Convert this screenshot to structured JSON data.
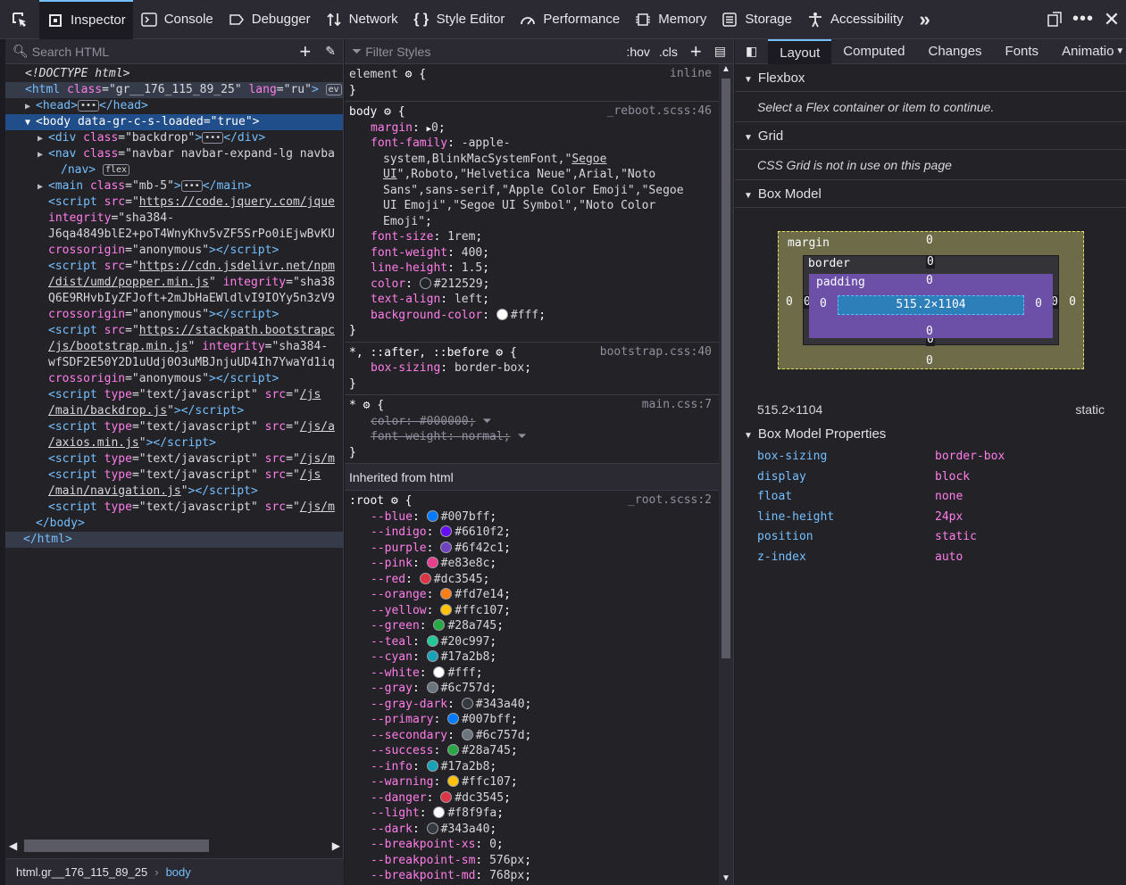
{
  "toolbar": {
    "tools": [
      "Inspector",
      "Console",
      "Debugger",
      "Network",
      "Style Editor",
      "Performance",
      "Memory",
      "Storage",
      "Accessibility"
    ]
  },
  "markup": {
    "search_placeholder": "Search HTML",
    "breadcrumb": [
      "html.gr__176_115_89_25",
      "body"
    ]
  },
  "rules": {
    "filter_placeholder": "Filter Styles",
    "hov": ":hov",
    "cls": ".cls",
    "inherited": "Inherited from html",
    "root_vars": [
      [
        "--blue",
        "#007bff",
        "#007bff"
      ],
      [
        "--indigo",
        "#6610f2",
        "#6610f2"
      ],
      [
        "--purple",
        "#6f42c1",
        "#6f42c1"
      ],
      [
        "--pink",
        "#e83e8c",
        "#e83e8c"
      ],
      [
        "--red",
        "#dc3545",
        "#dc3545"
      ],
      [
        "--orange",
        "#fd7e14",
        "#fd7e14"
      ],
      [
        "--yellow",
        "#ffc107",
        "#ffc107"
      ],
      [
        "--green",
        "#28a745",
        "#28a745"
      ],
      [
        "--teal",
        "#20c997",
        "#20c997"
      ],
      [
        "--cyan",
        "#17a2b8",
        "#17a2b8"
      ],
      [
        "--white",
        "#fff",
        "#ffffff"
      ],
      [
        "--gray",
        "#6c757d",
        "#6c757d"
      ],
      [
        "--gray-dark",
        "#343a40",
        "#343a40"
      ],
      [
        "--primary",
        "#007bff",
        "#007bff"
      ],
      [
        "--secondary",
        "#6c757d",
        "#6c757d"
      ],
      [
        "--success",
        "#28a745",
        "#28a745"
      ],
      [
        "--info",
        "#17a2b8",
        "#17a2b8"
      ],
      [
        "--warning",
        "#ffc107",
        "#ffc107"
      ],
      [
        "--danger",
        "#dc3545",
        "#dc3545"
      ],
      [
        "--light",
        "#f8f9fa",
        "#f8f9fa"
      ],
      [
        "--dark",
        "#343a40",
        "#343a40"
      ]
    ],
    "breakpoints": [
      [
        "--breakpoint-xs",
        "0"
      ],
      [
        "--breakpoint-sm",
        "576px"
      ],
      [
        "--breakpoint-md",
        "768px"
      ]
    ]
  },
  "layout": {
    "tabs": [
      "Layout",
      "Computed",
      "Changes",
      "Fonts",
      "Animatio"
    ],
    "flexbox": "Flexbox",
    "flex_note": "Select a Flex container or item to continue.",
    "grid": "Grid",
    "grid_note": "CSS Grid is not in use on this page",
    "boxmodel": "Box Model",
    "margin_label": "margin",
    "border_label": "border",
    "padding_label": "padding",
    "zero": "0",
    "content_size": "515.2×1104",
    "size_readout": "515.2×1104",
    "position_readout": "static",
    "props_title": "Box Model Properties",
    "props": [
      [
        "box-sizing",
        "border-box"
      ],
      [
        "display",
        "block"
      ],
      [
        "float",
        "none"
      ],
      [
        "line-height",
        "24px"
      ],
      [
        "position",
        "static"
      ],
      [
        "z-index",
        "auto"
      ]
    ]
  }
}
